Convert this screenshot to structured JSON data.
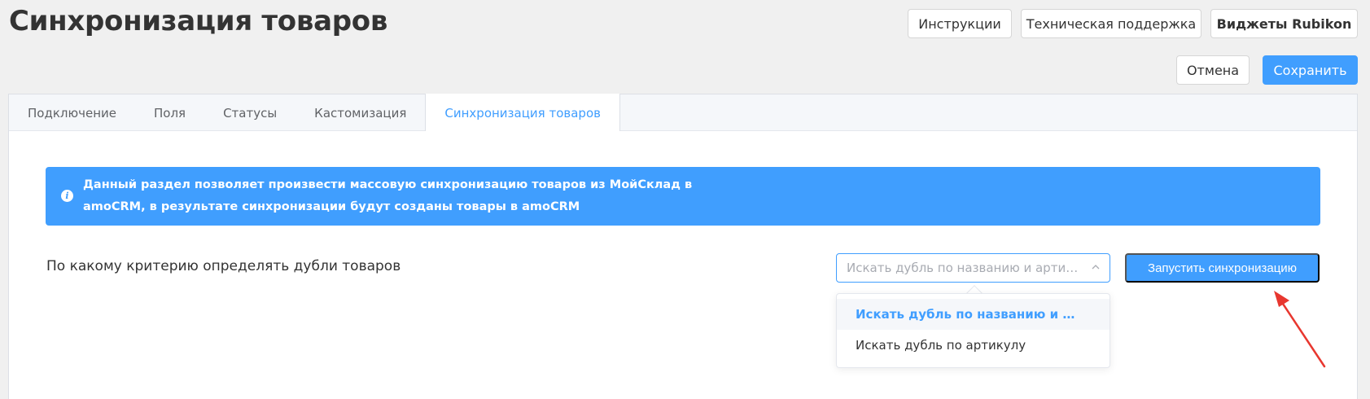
{
  "header": {
    "title": "Синхронизация товаров",
    "buttons": {
      "instructions": "Инструкции",
      "support": "Техническая поддержка",
      "widgets": "Виджеты Rubikon"
    },
    "cancel_label": "Отмена",
    "save_label": "Сохранить"
  },
  "tabs": [
    {
      "label": "Подключение"
    },
    {
      "label": "Поля"
    },
    {
      "label": "Статусы"
    },
    {
      "label": "Кастомизация"
    },
    {
      "label": "Синхронизация товаров",
      "active": true
    }
  ],
  "info": {
    "icon": "info-icon",
    "text": "Данный раздел позволяет произвести массовую синхронизацию товаров из МойСклад в amoCRM, в результате синхронизации будут созданы товары в amoCRM"
  },
  "criteria": {
    "label": "По какому критерию определять дубли товаров",
    "select_placeholder": "Искать дубль по названию и артикулу",
    "options": [
      {
        "label": "Искать дубль по названию и артикулу",
        "selected": true
      },
      {
        "label": "Искать дубль по артикулу",
        "selected": false
      }
    ],
    "run_label": "Запустить синхронизацию"
  },
  "colors": {
    "accent": "#409efe",
    "annotation_arrow": "#e8372f"
  }
}
